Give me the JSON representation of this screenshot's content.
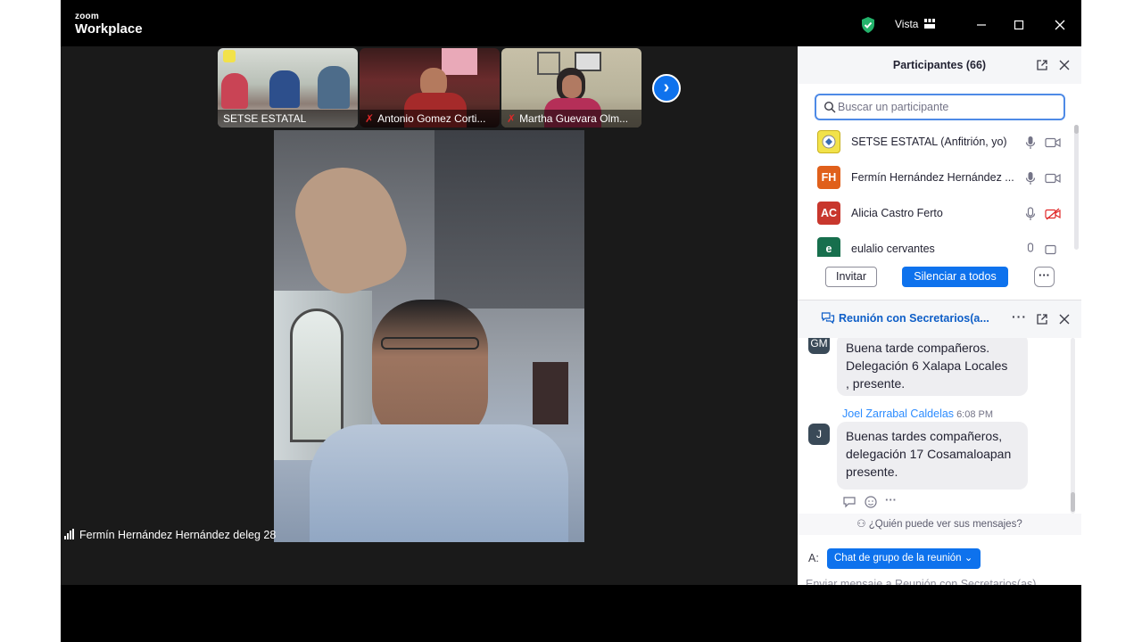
{
  "app": {
    "logo_top": "zoom",
    "logo_bottom": "Workplace",
    "view_label": "Vista"
  },
  "colors": {
    "accent": "#0e72ed",
    "shield": "#23b36b",
    "mic_off": "#e02828",
    "avatar_fh": "#e0601b",
    "avatar_ac": "#c8372d",
    "avatar_e": "#176f4d"
  },
  "thumbnails": [
    {
      "name": "SETSE ESTATAL",
      "muted": false
    },
    {
      "name": "Antonio Gomez Corti...",
      "muted": true
    },
    {
      "name": "Martha Guevara Olm...",
      "muted": true
    }
  ],
  "next_icon": "chevron-right-icon",
  "active_speaker": "Fermín Hernández Hernández deleg 28",
  "participants": {
    "title": "Participantes (66)",
    "search_placeholder": "Buscar un participante",
    "list": [
      {
        "initials": "",
        "name": "SETSE ESTATAL (Anfitrión, yo)",
        "avatar": "logo",
        "mic": "on",
        "video": "off"
      },
      {
        "initials": "FH",
        "name": "Fermín Hernández Hernández ...",
        "avatar": "orange",
        "mic": "on",
        "video": "off"
      },
      {
        "initials": "AC",
        "name": "Alicia Castro Ferto",
        "avatar": "red",
        "mic": "on",
        "video": "muted"
      },
      {
        "initials": "e",
        "name": "eulalio cervantes",
        "avatar": "green",
        "mic": "on",
        "video": "off"
      }
    ],
    "invite_label": "Invitar",
    "mute_all_label": "Silenciar a todos",
    "more_label": "···"
  },
  "chat": {
    "title": "Reunión con Secretarios(a...",
    "messages": [
      {
        "sender": "",
        "initials": "GM",
        "time": "",
        "lines": [
          "Buena tarde compañeros.",
          "Delegación 6 Xalapa Locales",
          ", presente."
        ]
      },
      {
        "sender": "Joel Zarrabal Caldelas",
        "initials": "J",
        "time": "6:08 PM",
        "lines": [
          "Buenas tardes compañeros,",
          "delegación 17 Cosamaloapan",
          "presente."
        ]
      }
    ],
    "visibility_note": "¿Quién puede ver sus mensajes?",
    "to_label": "A:",
    "to_target": "Chat de grupo de la reunión",
    "compose_placeholder": "Enviar mensaje a Reunión con Secretarios(as)..."
  }
}
